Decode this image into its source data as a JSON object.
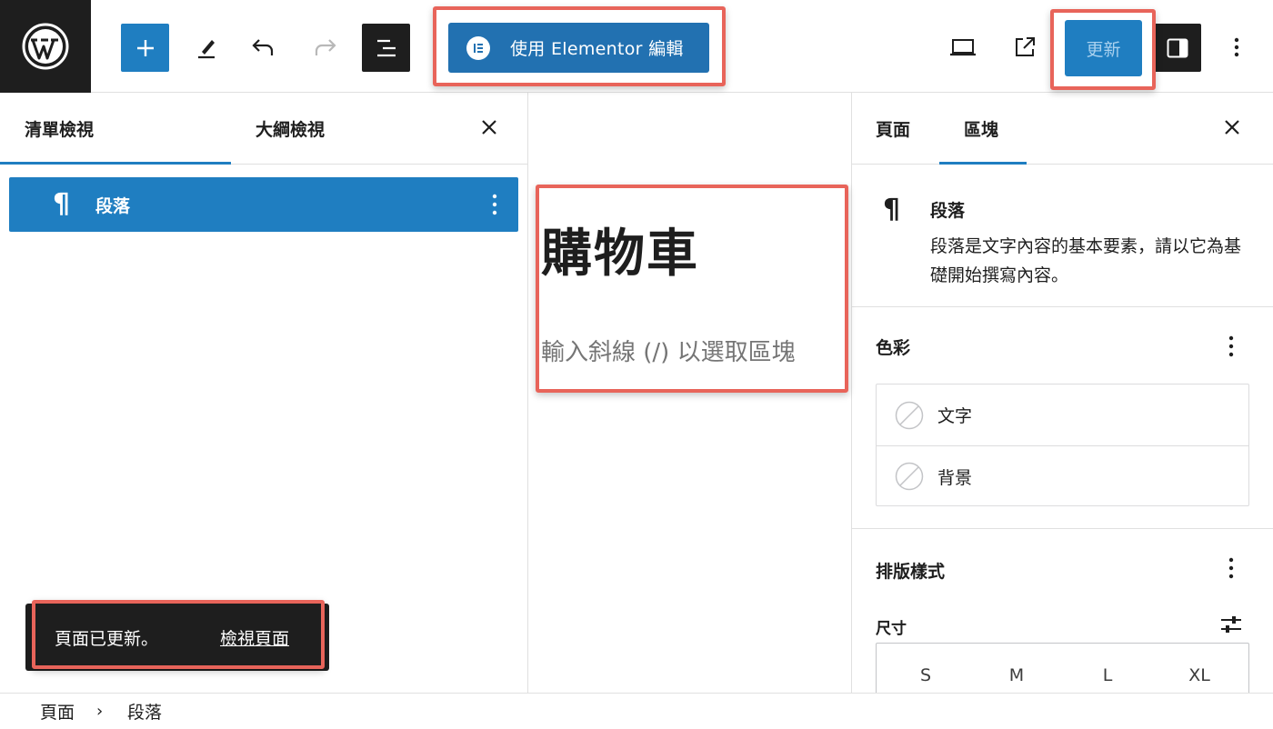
{
  "toolbar": {
    "logo_icon": "wordpress-logo",
    "add_icon": "plus-icon",
    "tools_icon": "pen-icon",
    "undo_icon": "undo-icon",
    "redo_icon": "redo-icon",
    "listview_icon": "list-view-icon",
    "elementor_label": "使用 Elementor 編輯",
    "preview_icon": "laptop-icon",
    "view_post_icon": "external-link-icon",
    "update_label": "更新",
    "settings_icon": "sidebar-toggle-icon",
    "options_icon": "kebab-icon"
  },
  "left_panel": {
    "tabs": [
      {
        "label": "清單檢視",
        "active": true
      },
      {
        "label": "大綱檢視",
        "active": false
      }
    ],
    "close_icon": "close-icon",
    "list_items": [
      {
        "icon": "paragraph-icon",
        "label": "段落",
        "selected": true
      }
    ]
  },
  "snackbar": {
    "message": "頁面已更新。",
    "link": "檢視頁面"
  },
  "canvas": {
    "title": "購物車",
    "placeholder": "輸入斜線 (/) 以選取區塊"
  },
  "right_panel": {
    "tabs": [
      {
        "label": "頁面",
        "active": false
      },
      {
        "label": "區塊",
        "active": true
      }
    ],
    "close_icon": "close-icon",
    "block_card": {
      "icon": "paragraph-icon",
      "title": "段落",
      "description": "段落是文字內容的基本要素，請以它為基礎開始撰寫內容。"
    },
    "color": {
      "title": "色彩",
      "items": [
        {
          "label": "文字"
        },
        {
          "label": "背景"
        }
      ]
    },
    "typography": {
      "title": "排版樣式",
      "size_label": "尺寸",
      "sizes": [
        "S",
        "M",
        "L",
        "XL"
      ]
    }
  },
  "breadcrumb": {
    "items": [
      "頁面",
      "段落"
    ],
    "separator": "›"
  },
  "colors": {
    "accent": "#1f7ec1",
    "dark": "#1e1e1e",
    "highlight": "#e8645a"
  }
}
